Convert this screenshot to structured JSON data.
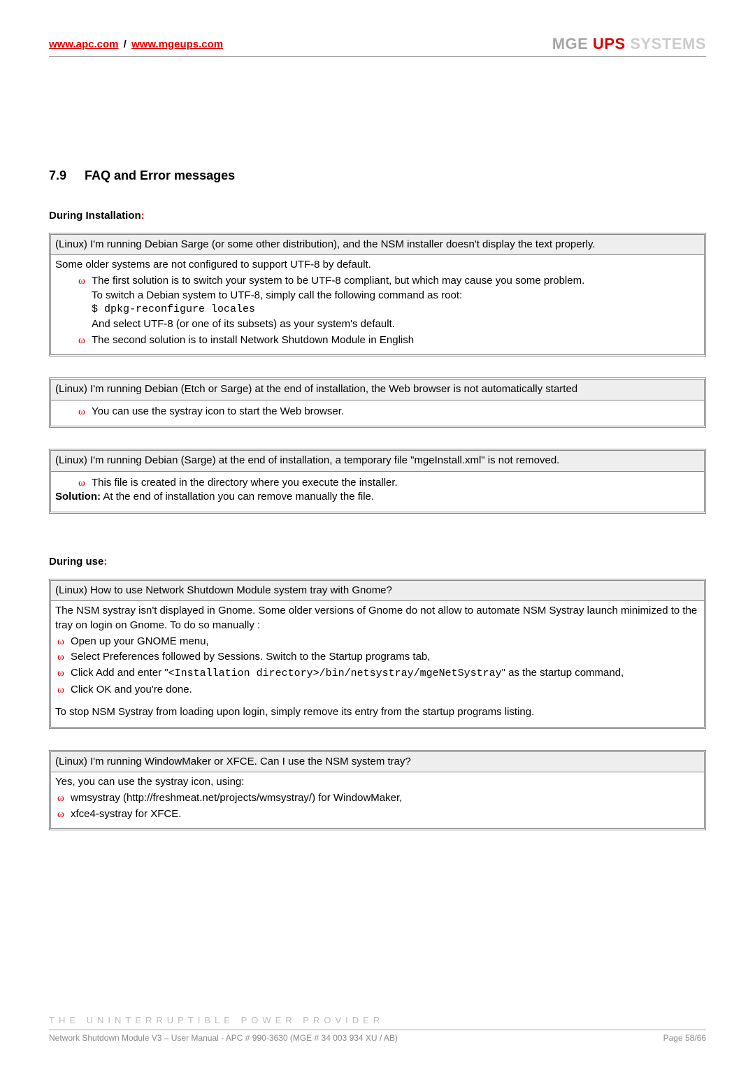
{
  "header": {
    "link1": "www.apc.com",
    "sep": "/",
    "link2": "www.mgeups.com",
    "brand_mge": "MGE",
    "brand_ups": "UPS",
    "brand_sys": "SYSTEMS"
  },
  "section": {
    "number": "7.9",
    "title": "FAQ and Error messages"
  },
  "install": {
    "heading": "During Installation",
    "colon": ":",
    "q1": "(Linux) I'm running Debian Sarge (or some other distribution), and the NSM installer doesn't display the text properly.",
    "a1": {
      "intro": "Some older systems are not configured to support UTF-8 by default.",
      "b1a": "The first solution is to switch your system to be UTF-8 compliant, but which may cause you some problem.",
      "b1b": "To switch a Debian system to UTF-8, simply call the following command as root:",
      "b1c": "$ dpkg-reconfigure locales",
      "b1d": "And select UTF-8 (or one of its subsets) as your system's default.",
      "b2": "The second solution is to install Network Shutdown Module in English"
    },
    "q2": "(Linux) I'm running Debian (Etch or Sarge) at the end of installation, the Web browser is not automatically started",
    "a2": {
      "b1": "You can use the systray icon to start the Web browser."
    },
    "q3": "(Linux) I'm running Debian (Sarge) at the end of installation, a temporary file \"mgeInstall.xml\" is not removed.",
    "a3": {
      "b1": "This file is created in the directory where you execute the installer.",
      "sol_label": "Solution:",
      "sol_text": " At the end of installation you can remove manually the file."
    }
  },
  "use": {
    "heading": "During use",
    "colon": ":",
    "q1": "(Linux) How to use Network Shutdown Module system tray with Gnome?",
    "a1": {
      "intro": " The NSM systray isn't displayed in Gnome. Some older versions of Gnome do not allow to automate NSM Systray launch minimized to the tray on login on Gnome. To do so manually :",
      "b1": "Open up your GNOME menu,",
      "b2": "Select Preferences followed by Sessions. Switch to the Startup programs tab,",
      "b3a": "Click Add and enter \"",
      "b3b": "<Installation directory>/bin/netsystray/mgeNetSystray",
      "b3c": "\" as the startup command,",
      "b4": "Click OK and you're done.",
      "outro": "To stop NSM Systray from loading upon login, simply remove its entry from the startup programs listing."
    },
    "q2": "(Linux) I'm running WindowMaker or XFCE. Can I use the NSM system tray?",
    "a2": {
      "intro": " Yes, you can use the systray icon, using:",
      "b1": "wmsystray (http://freshmeat.net/projects/wmsystray/) for WindowMaker,",
      "b2": "xfce4-systray for XFCE."
    }
  },
  "footer": {
    "tagline": "THE UNINTERRUPTIBLE POWER PROVIDER",
    "docinfo": "Network Shutdown Module V3 – User Manual - APC # 990-3630 (MGE # 34 003 934 XU / AB)",
    "page": "Page 58/66"
  },
  "bullet": "ω"
}
